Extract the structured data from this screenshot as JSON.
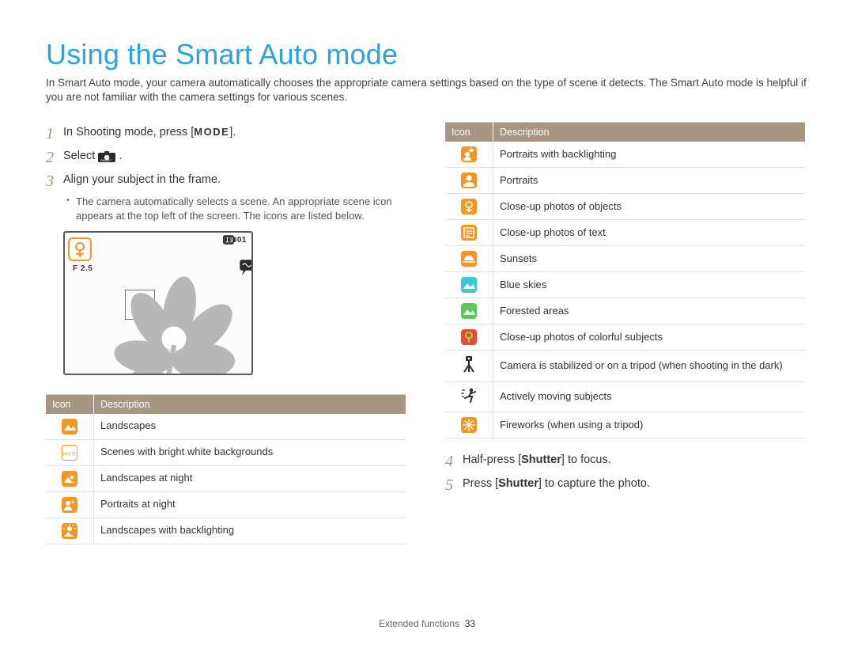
{
  "title": "Using the Smart Auto mode",
  "intro": "In Smart Auto mode, your camera automatically chooses the appropriate camera settings based on the type of scene it detects. The Smart Auto mode is helpful if you are not familiar with the camera settings for various scenes.",
  "steps": {
    "s1": {
      "num": "1",
      "pre": "In Shooting mode, press [",
      "key": "MODE",
      "post": "]."
    },
    "s2": {
      "num": "2",
      "text": "Select "
    },
    "s3": {
      "num": "3",
      "text": "Align your subject in the frame."
    },
    "s3_sub": "The camera automatically selects a scene. An appropriate scene icon appears at the top left of the screen. The icons are listed below.",
    "s4": {
      "num": "4",
      "pre": "Half-press [",
      "key": "Shutter",
      "post": "] to focus."
    },
    "s5": {
      "num": "5",
      "pre": "Press [",
      "key": "Shutter",
      "post": "] to capture the photo."
    }
  },
  "lcd": {
    "counter": "00001",
    "aperture": "F 2.5"
  },
  "table_headers": {
    "icon": "Icon",
    "desc": "Description"
  },
  "table_left": [
    {
      "desc": "Landscapes"
    },
    {
      "desc": "Scenes with bright white backgrounds"
    },
    {
      "desc": "Landscapes at night"
    },
    {
      "desc": "Portraits at night"
    },
    {
      "desc": "Landscapes with backlighting"
    }
  ],
  "table_right": [
    {
      "desc": "Portraits with backlighting"
    },
    {
      "desc": "Portraits"
    },
    {
      "desc": "Close-up photos of objects"
    },
    {
      "desc": "Close-up photos of text"
    },
    {
      "desc": "Sunsets"
    },
    {
      "desc": "Blue skies"
    },
    {
      "desc": "Forested areas"
    },
    {
      "desc": "Close-up photos of colorful subjects"
    },
    {
      "desc": "Camera is stabilized or on a tripod (when shooting in the dark)"
    },
    {
      "desc": "Actively moving subjects"
    },
    {
      "desc": "Fireworks (when using a tripod)"
    }
  ],
  "footer": {
    "section": "Extended functions",
    "page": "33"
  }
}
